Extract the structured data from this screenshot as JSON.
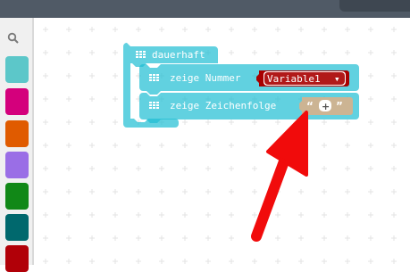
{
  "blocks": {
    "forever_label": "dauerhaft",
    "show_number_label": "zeige Nummer",
    "variable_name": "Variable1",
    "variable_dropdown_glyph": "▾",
    "show_string_label": "zeige Zeichenfolge",
    "open_quote": "“",
    "close_quote": "”",
    "plus_glyph": "+"
  },
  "toolbox": {
    "search_icon": "search-icon",
    "categories": [
      {
        "color": "#5cc7c9"
      },
      {
        "color": "#d4007c"
      },
      {
        "color": "#e05b00"
      },
      {
        "color": "#9a6ee6"
      },
      {
        "color": "#118817"
      },
      {
        "color": "#00686d"
      },
      {
        "color": "#b10008"
      }
    ]
  },
  "colors": {
    "basic_block": "#1ebed3",
    "variable_block": "#a80000",
    "text_block": "#ccb493",
    "arrow": "#f10b0b"
  }
}
